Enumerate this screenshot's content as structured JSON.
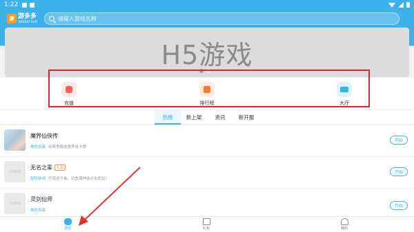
{
  "status_bar": {
    "time": "1:22"
  },
  "header": {
    "logo_mark": "游",
    "logo_title": "游多多",
    "logo_subtitle": "YOUDUO DUO",
    "search_placeholder": "请输入游戏名称"
  },
  "banner": {
    "title": "H5游戏",
    "slides": 2,
    "active_slide": 1
  },
  "quick_actions": [
    {
      "label": "充值",
      "icon": "wallet-icon"
    },
    {
      "label": "排行榜",
      "icon": "trophy-icon"
    },
    {
      "label": "大厅",
      "icon": "gamepad-icon"
    }
  ],
  "tabs": [
    {
      "label": "热推",
      "active": true
    },
    {
      "label": "新上架",
      "active": false
    },
    {
      "label": "资讯",
      "active": false
    },
    {
      "label": "新开服",
      "active": false
    }
  ],
  "games": [
    {
      "name": "魔界仙侠传",
      "tag": "",
      "category": "角色扮演",
      "desc": "经典策略放置养成卡牌",
      "thumb": "",
      "action": "开始"
    },
    {
      "name": "无名之辈",
      "tag": "礼包",
      "category": "轻松休闲",
      "desc": "开局送千抽，钓鱼爆神装点击即玩！",
      "thumb": "H5游戏",
      "action": "开始"
    },
    {
      "name": "灵剑仙师",
      "tag": "",
      "category": "角色扮演",
      "desc": "",
      "thumb": "H5游戏",
      "action": "开始"
    }
  ],
  "bottom_nav": [
    {
      "label": "游戏",
      "active": true
    },
    {
      "label": "礼包",
      "active": false
    },
    {
      "label": "我的",
      "active": false
    }
  ],
  "colors": {
    "brand": "#3db1ea",
    "highlight": "#d9252e",
    "accent": "#ff8a3a"
  }
}
